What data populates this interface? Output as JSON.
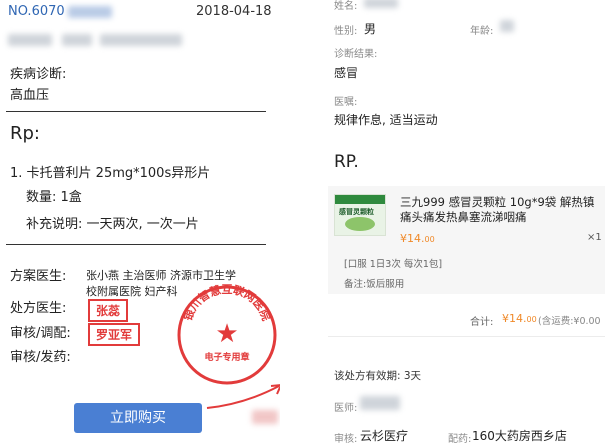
{
  "left": {
    "no_prefix": "NO.6070",
    "date": "2018-04-18",
    "diagnosis_label": "疾病诊断:",
    "diagnosis_value": "高血压",
    "rp_label": "Rp:",
    "med_line": "1. 卡托普利片 25mg*100s异形片",
    "qty_line": "数量: 1盒",
    "note_line": "补充说明: 一天两次, 一次一片",
    "plan_doctor_label": "方案医生:",
    "plan_doctor_value_1": "张小燕  主治医师  济源市卫生学",
    "plan_doctor_value_2": "校附属医院  妇产科",
    "rx_doctor_label": "处方医生:",
    "rx_doctor_signature": "张蕊",
    "review_label": "审核/调配:",
    "review_signature": "罗亚军",
    "dispense_label": "审核/发药:",
    "buy_button": "立即购买",
    "stamp": {
      "ring_text": "银川智慧互联网医院",
      "center_star": "★",
      "bottom_text": "电子专用章"
    }
  },
  "right": {
    "name_label": "姓名:",
    "gender_label": "性别:",
    "gender_value": "男",
    "age_label": "年龄:",
    "result_label": "诊断结果:",
    "result_value": "感冒",
    "advice_label": "医嘱:",
    "advice_value": "规律作息, 适当运动",
    "rp_label": "RP.",
    "drug": {
      "name_line_1": "三九999 感冒灵颗粒 10g*9袋 解热镇",
      "name_line_2": "痛头痛发热鼻塞流涕咽痛",
      "price": "¥14.",
      "price_cents": "00",
      "quantity": "×1",
      "usage": "[口服 1日3次 每次1包]",
      "remark": "备注:饭后服用",
      "box_text": "感冒灵颗粒"
    },
    "total_label": "合计:",
    "total_value": "¥14.",
    "total_cents": "00",
    "shipping": "(含运费:¥0.00",
    "valid_label": "该处方有效期: 3天",
    "doctor_label": "医师:",
    "reviewer_label": "审核:",
    "reviewer_value": "云杉医疗",
    "dispenser_label": "配药:",
    "dispenser_value": "160大药房西乡店"
  },
  "colors": {
    "accent_blue": "#4a7fd3",
    "stamp_red": "#e23b3b",
    "price_orange": "#f08a2a"
  }
}
